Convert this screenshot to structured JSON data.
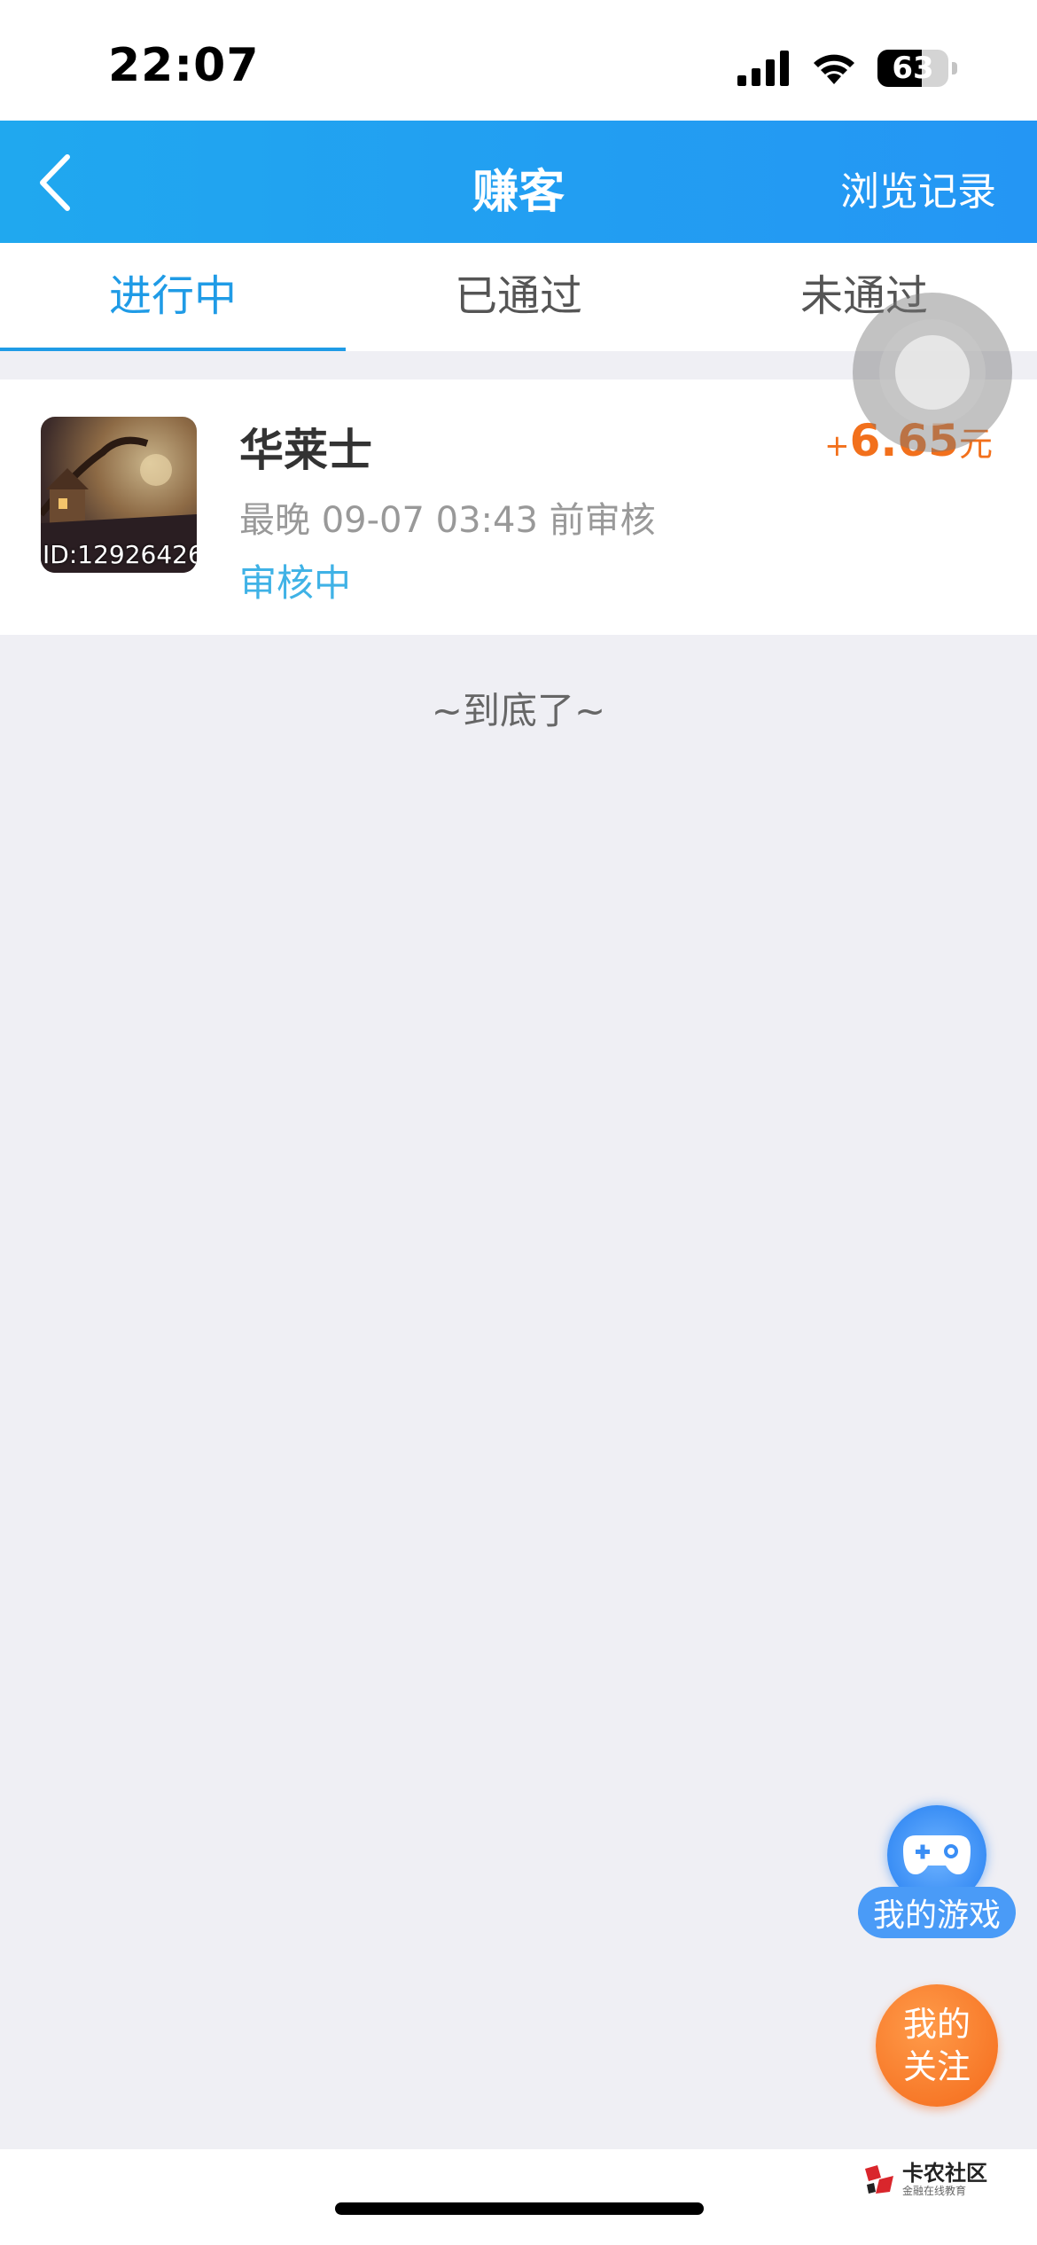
{
  "status_bar": {
    "time": "22:07",
    "battery": "63",
    "battery_level": 0.63
  },
  "nav": {
    "title": "赚客",
    "right_label": "浏览记录"
  },
  "tabs": [
    {
      "label": "进行中",
      "active": true
    },
    {
      "label": "已通过",
      "active": false
    },
    {
      "label": "未通过",
      "active": false
    }
  ],
  "task": {
    "thumb_id": "ID:12926426",
    "title": "华莱士",
    "deadline": "最晚 09-07 03:43 前审核",
    "status": "审核中",
    "reward_plus": "+",
    "reward_amount": "6.65",
    "reward_unit": "元"
  },
  "end_text": "~到底了~",
  "fab": {
    "games_label": "我的游戏",
    "follow_label": "我的关注"
  },
  "watermark": {
    "main": "卡农社区",
    "sub": "金融在线教育"
  },
  "colors": {
    "nav_blue": "#2496f4",
    "tab_active": "#1f9be6",
    "status_cyan": "#3fb2e6",
    "reward_orange": "#f2701c"
  }
}
